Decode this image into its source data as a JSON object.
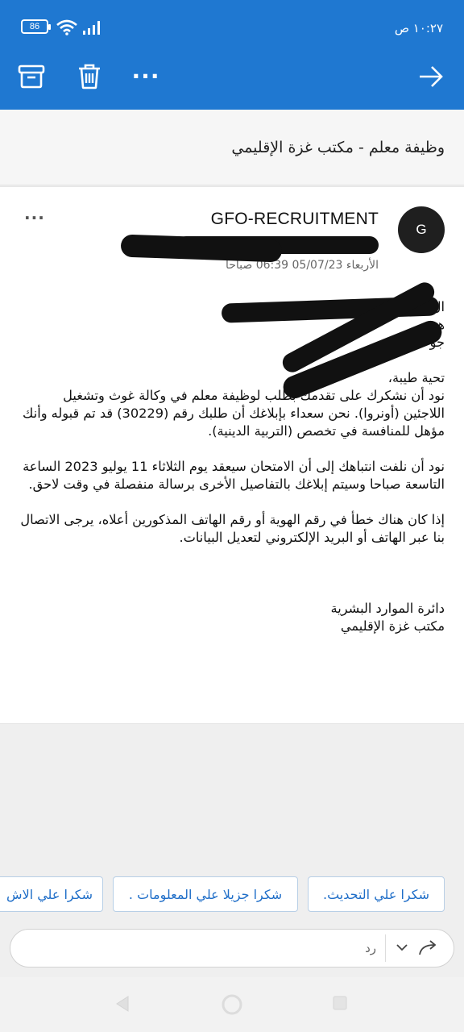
{
  "status_bar": {
    "battery": "86",
    "time": "١٠:٢٧ ص"
  },
  "toolbar": {
    "icons": [
      "archive-icon",
      "delete-icon",
      "more-icon",
      "forward-arrow-icon"
    ],
    "more_label": "···"
  },
  "email": {
    "subject": "وظيفة معلم - مكتب غزة الإقليمي",
    "avatar_letter": "G",
    "sender": "GFO-RECRUITMENT",
    "date": "الأربعاء 05/07/23 06:39 صباحاً",
    "more_label": "···",
    "body": {
      "lines_redacted": [
        "ال",
        "هـ",
        "جو"
      ],
      "greeting": "تحية طيبة،",
      "p1": "نود أن نشكرك على تقدمك بطلب لوظيفة معلم في وكالة غوث وتشغيل اللاجئين (أونروا). نحن سعداء بإبلاغك أن طلبك رقم (30229) قد تم قبوله وأنك مؤهل للمنافسة في تخصص (التربية الدينية).",
      "p2": "نود أن نلفت انتباهك إلى أن الامتحان سيعقد يوم الثلاثاء 11 يوليو 2023 الساعة التاسعة صباحا وسيتم إبلاغك بالتفاصيل الأخرى برسالة منفصلة في وقت لاحق.",
      "p3": "إذا كان هناك خطأ في رقم الهوية أو رقم الهاتف المذكورين أعلاه، يرجى الاتصال بنا عبر الهاتف أو البريد الإلكتروني لتعديل البيانات.",
      "signature_line1": "دائرة الموارد البشرية",
      "signature_line2": "مكتب غزة الإقليمي"
    }
  },
  "quick_replies": [
    "شكرا علي التحديث.",
    "شكرا جزيلا علي المعلومات .",
    "شكرا علي الاش"
  ],
  "reply_bar": {
    "placeholder": "رد"
  },
  "colors": {
    "app_bar": "#1f78d1",
    "chip_text": "#1f6ec8"
  }
}
